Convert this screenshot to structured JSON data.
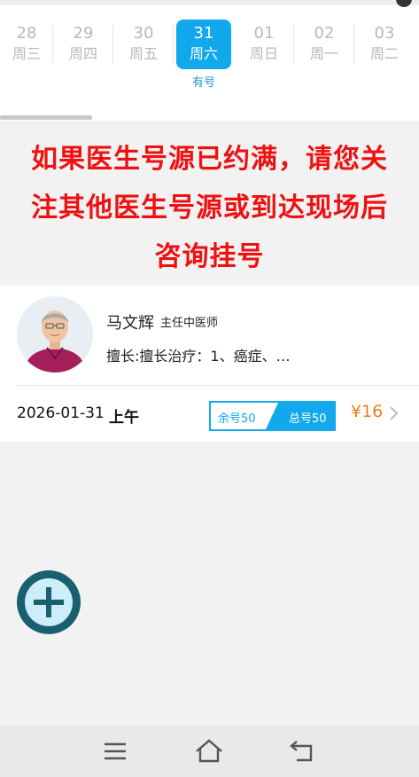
{
  "date_strip": {
    "days": [
      {
        "num": "28",
        "weekday": "周三",
        "status": ""
      },
      {
        "num": "29",
        "weekday": "周四",
        "status": ""
      },
      {
        "num": "30",
        "weekday": "周五",
        "status": ""
      },
      {
        "num": "31",
        "weekday": "周六",
        "status": "有号",
        "selected": true
      },
      {
        "num": "01",
        "weekday": "周日",
        "status": ""
      },
      {
        "num": "02",
        "weekday": "周一",
        "status": ""
      },
      {
        "num": "03",
        "weekday": "周二",
        "status": ""
      }
    ]
  },
  "notice": {
    "lines": [
      "如果医生号源已约满，请您关",
      "注其他医生号源或到达现场后",
      "咨询挂号"
    ]
  },
  "doctor": {
    "name": "马文辉",
    "title": "主任中医师",
    "specialty": "擅长:擅长治疗：1、癌症、…"
  },
  "slot": {
    "date": "2026-01-31",
    "period": "上午",
    "remaining_label": "余号50",
    "total_label": "总号50",
    "price": "¥16"
  },
  "fab": {
    "icon": "plus-icon"
  },
  "nav": {
    "icons": [
      "menu-icon",
      "home-icon",
      "back-icon"
    ]
  },
  "colors": {
    "accent": "#12a8ec",
    "notice_red": "#ee1111",
    "price_orange": "#f07c1c"
  }
}
